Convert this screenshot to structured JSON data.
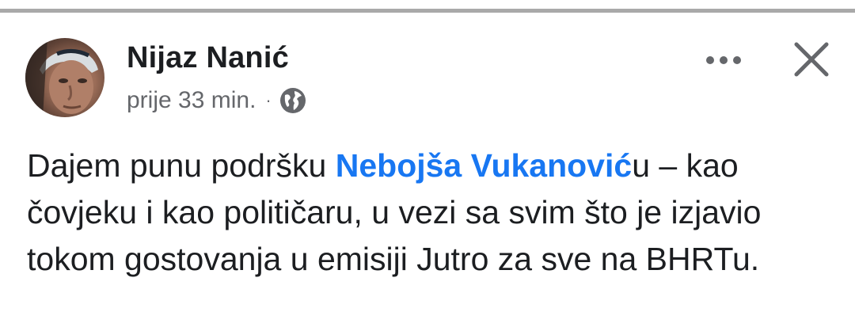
{
  "post": {
    "author_name": "Nijaz Nanić",
    "timestamp": "prije 33 min.",
    "separator": "·",
    "audience_icon": "globe-icon",
    "more_icon": "more-options-icon",
    "close_icon": "close-icon",
    "text_before_mention": "Dajem punu podršku ",
    "mention": "Nebojša Vukanović",
    "text_after_mention": "u – kao čovjeku i kao političaru, u vezi sa svim što je izjavio tokom gostovanja u emisiji Jutro za sve na BHRTu."
  },
  "colors": {
    "mention": "#1877f2",
    "text": "#1c1e21",
    "secondary_text": "#65676b",
    "divider": "#a9a9a9"
  }
}
